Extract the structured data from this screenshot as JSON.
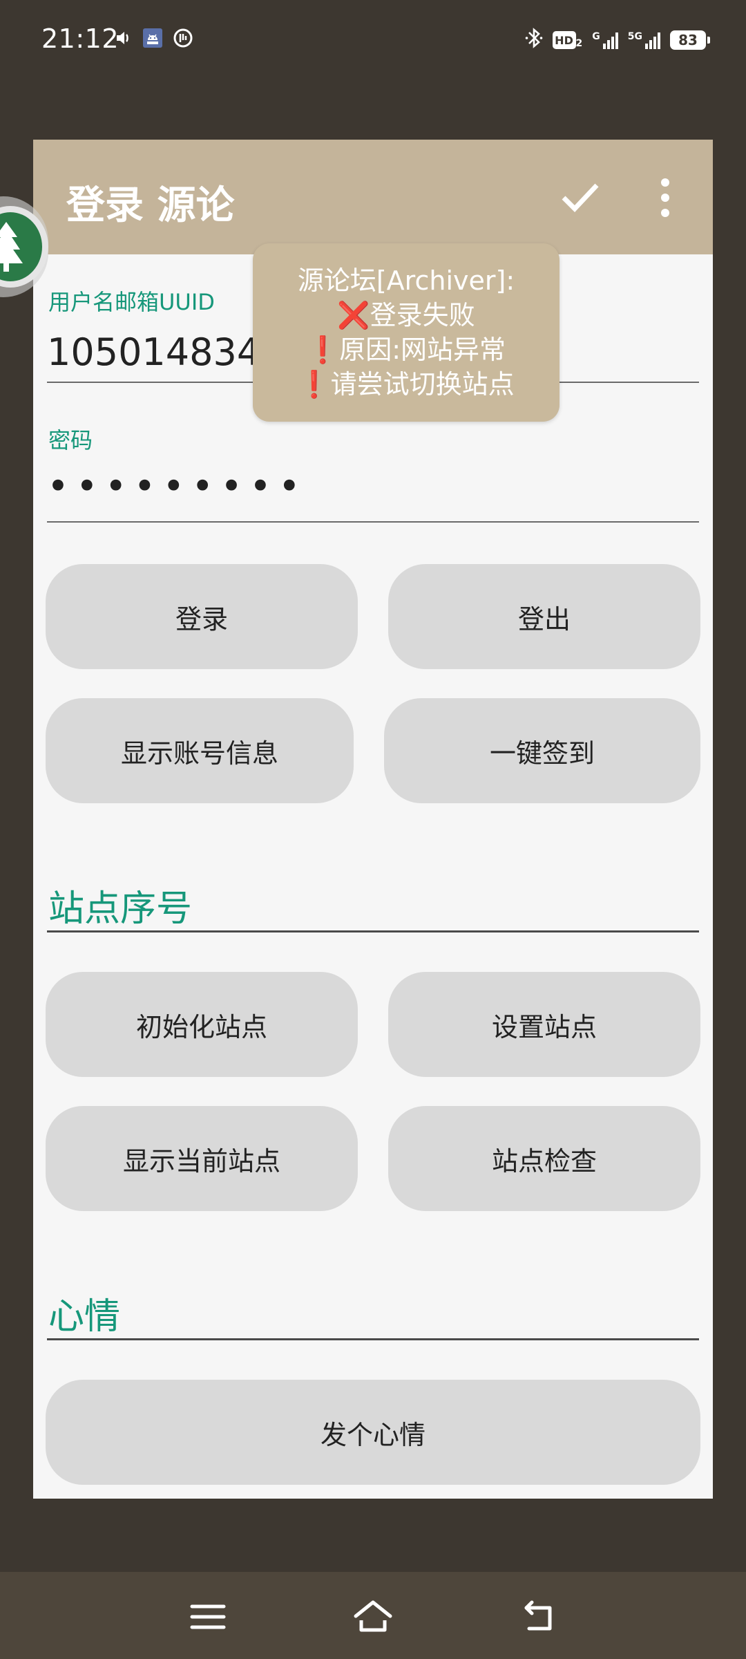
{
  "status_bar": {
    "time": "21:12",
    "icons_left": [
      "volume-icon",
      "android-app-icon",
      "vpn-icon"
    ],
    "icons_right": [
      "bluetooth-icon",
      "hd-voice-icon",
      "signal-icon",
      "signal-5g-icon",
      "battery-icon"
    ],
    "hd_label": "HD",
    "hd_sub": "2",
    "sig1_label": "G",
    "sig2_label": "5G",
    "battery_level": "83"
  },
  "toolbar": {
    "title": "登录 源论",
    "check_icon": "check-icon",
    "more_icon": "more-vert-icon"
  },
  "toast": {
    "line1": "源论坛[Archiver]:",
    "line2_mark": "❌",
    "line2": "登录失败",
    "line3_mark": "❗",
    "line3": "原因:网站异常",
    "line4_mark": "❗",
    "line4": "请尝试切换站点"
  },
  "form": {
    "username": {
      "label": "用户名邮箱UUID",
      "value": "1050148346"
    },
    "password": {
      "label": "密码",
      "value": "•••••••••"
    }
  },
  "buttons": {
    "login": "登录",
    "logout": "登出",
    "show_account": "显示账号信息",
    "sign_in": "一键签到",
    "init_site": "初始化站点",
    "set_site": "设置站点",
    "show_site": "显示当前站点",
    "check_site": "站点检查",
    "post_mood": "发个心情"
  },
  "sections": {
    "site_number": "站点序号",
    "mood": "心情"
  },
  "nav": {
    "menu_icon": "menu-icon",
    "home_icon": "home-icon",
    "back_icon": "back-icon"
  },
  "colors": {
    "background": "#3d3730",
    "toolbar": "#c4b49a",
    "accent_text": "#16977a",
    "button_bg": "#d9d9d9",
    "toast_bg": "#c9b99c",
    "nav_bar": "#4e463b"
  }
}
